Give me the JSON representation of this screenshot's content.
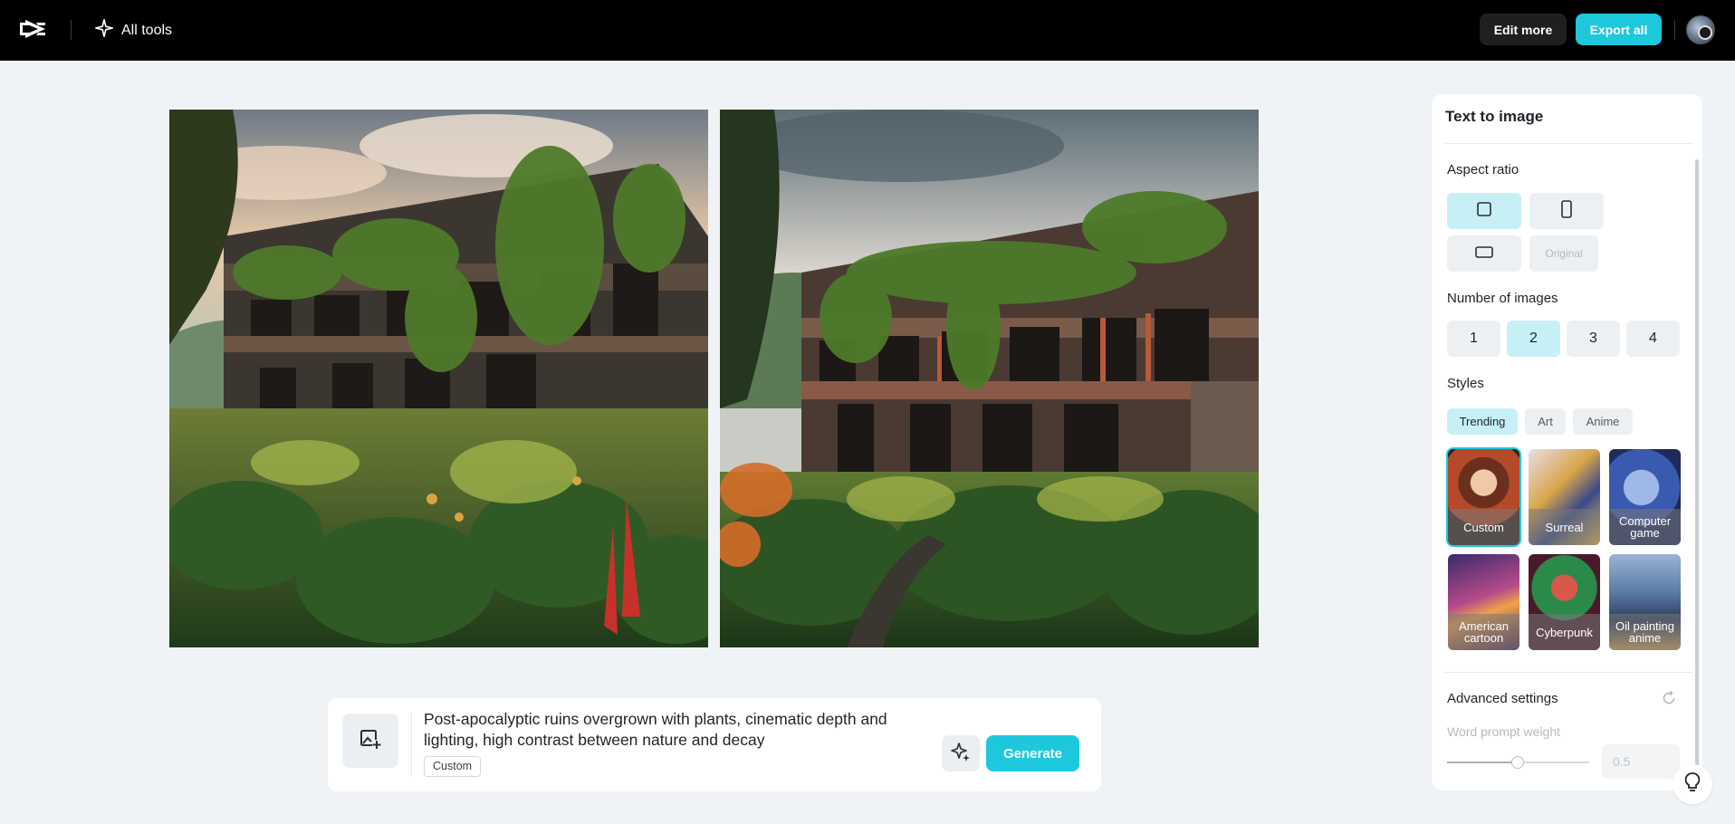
{
  "topbar": {
    "logo_icon": "capcut-logo-icon",
    "all_tools_label": "All tools",
    "all_tools_icon": "sparkle-icon",
    "edit_more_label": "Edit more",
    "export_all_label": "Export all",
    "avatar_icon": "user-avatar"
  },
  "canvas": {
    "images": [
      {
        "name": "generated-image-1"
      },
      {
        "name": "generated-image-2"
      }
    ]
  },
  "prompt": {
    "upload_icon": "image-upload-icon",
    "text": "Post-apocalyptic ruins overgrown with plants, cinematic depth and lighting, high contrast between nature and decay",
    "style_tag": "Custom",
    "magic_icon": "magic-sparkle-icon",
    "generate_label": "Generate"
  },
  "panel": {
    "title": "Text to image",
    "aspect_ratio": {
      "label": "Aspect ratio",
      "options": [
        {
          "icon": "square-ratio-icon",
          "selected": true
        },
        {
          "icon": "portrait-ratio-icon",
          "selected": false
        },
        {
          "icon": "landscape-ratio-icon",
          "selected": false
        },
        {
          "label": "Original",
          "selected": false
        }
      ]
    },
    "number_of_images": {
      "label": "Number of images",
      "options": [
        "1",
        "2",
        "3",
        "4"
      ],
      "selected": "2"
    },
    "styles": {
      "label": "Styles",
      "tabs": [
        "Trending",
        "Art",
        "Anime"
      ],
      "selected_tab": "Trending",
      "items": [
        {
          "label": "Custom",
          "selected": true
        },
        {
          "label": "Surreal",
          "selected": false
        },
        {
          "label": "Computer game",
          "selected": false
        },
        {
          "label": "American cartoon",
          "selected": false
        },
        {
          "label": "Cyberpunk",
          "selected": false
        },
        {
          "label": "Oil painting anime",
          "selected": false
        }
      ]
    },
    "advanced": {
      "label": "Advanced settings",
      "reset_icon": "reset-icon",
      "word_prompt_weight_label": "Word prompt weight",
      "word_prompt_weight_value": "0.5"
    }
  },
  "help_icon": "lightbulb-icon",
  "colors": {
    "accent": "#1dc8dd",
    "selected_bg": "#c6f0f5",
    "topbar_bg": "#000000",
    "page_bg": "#eff3f6"
  }
}
